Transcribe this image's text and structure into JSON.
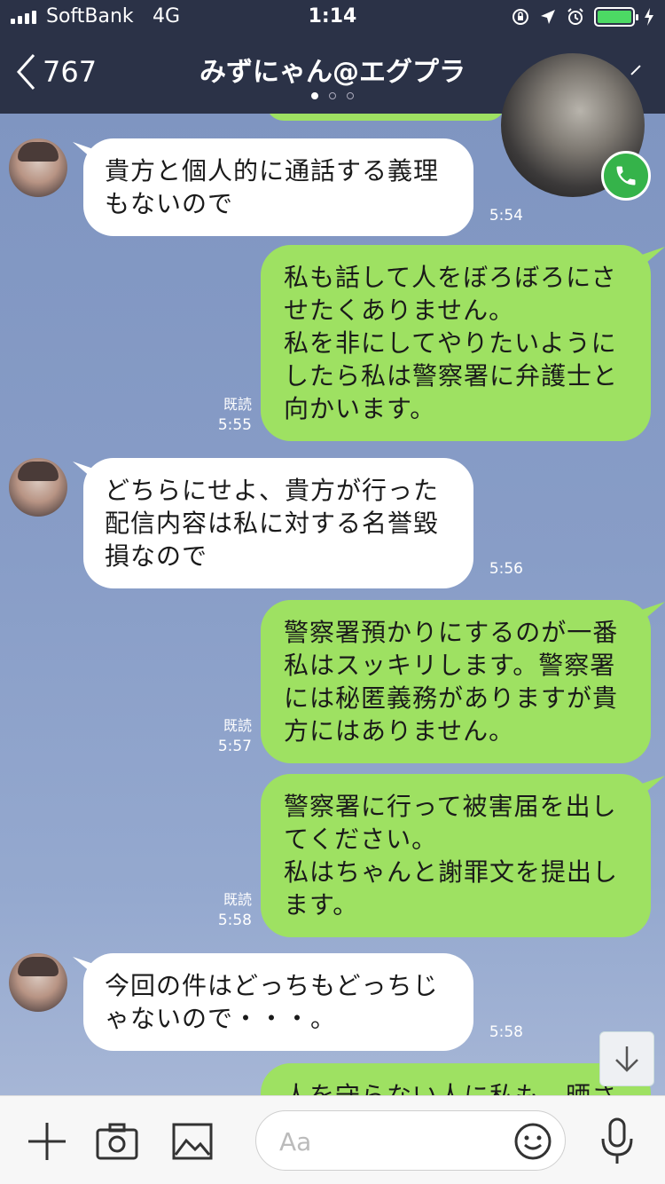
{
  "status": {
    "carrier": "SoftBank",
    "network": "4G",
    "time": "1:14"
  },
  "header": {
    "back_count": "767",
    "title": "みずにゃん@エグプラ"
  },
  "messages": [
    {
      "side": "in",
      "text": "貴方と個人的に通話する義理\nもないので",
      "time": "5:54"
    },
    {
      "side": "out",
      "text": "私も話して人をぼろぼろにさ\nせたくありません。\n私を非にしてやりたいように\nしたら私は警察署に弁護士と\n向かいます。",
      "read": "既読",
      "time": "5:55"
    },
    {
      "side": "in",
      "text": "どちらにせよ、貴方が行った\n配信内容は私に対する名誉毀\n損なので",
      "time": "5:56"
    },
    {
      "side": "out",
      "text": "警察署預かりにするのが一番\n私はスッキリします。警察署\nには秘匿義務がありますが貴\n方にはありません。",
      "read": "既読",
      "time": "5:57"
    },
    {
      "side": "out",
      "text": "警察署に行って被害届を出し\nてください。\n私はちゃんと謝罪文を提出し\nます。",
      "read": "既読",
      "time": "5:58"
    },
    {
      "side": "in",
      "text": "今回の件はどっちもどっちじ\nゃないので・・・。",
      "time": "5:58"
    },
    {
      "side": "out",
      "text": "人を守らない人に私も、晒さ",
      "read": "",
      "time": ""
    }
  ],
  "input": {
    "placeholder": "Aa"
  },
  "icons": {
    "plus": "plus-icon",
    "camera": "camera-icon",
    "image": "image-icon",
    "emoji": "emoji-icon",
    "mic": "microphone-icon",
    "call": "phone-icon",
    "scroll": "arrow-down-icon"
  },
  "colors": {
    "header_bg": "#2b3247",
    "out_bubble": "#9ee162",
    "in_bubble": "#ffffff",
    "call_green": "#35b34a"
  }
}
